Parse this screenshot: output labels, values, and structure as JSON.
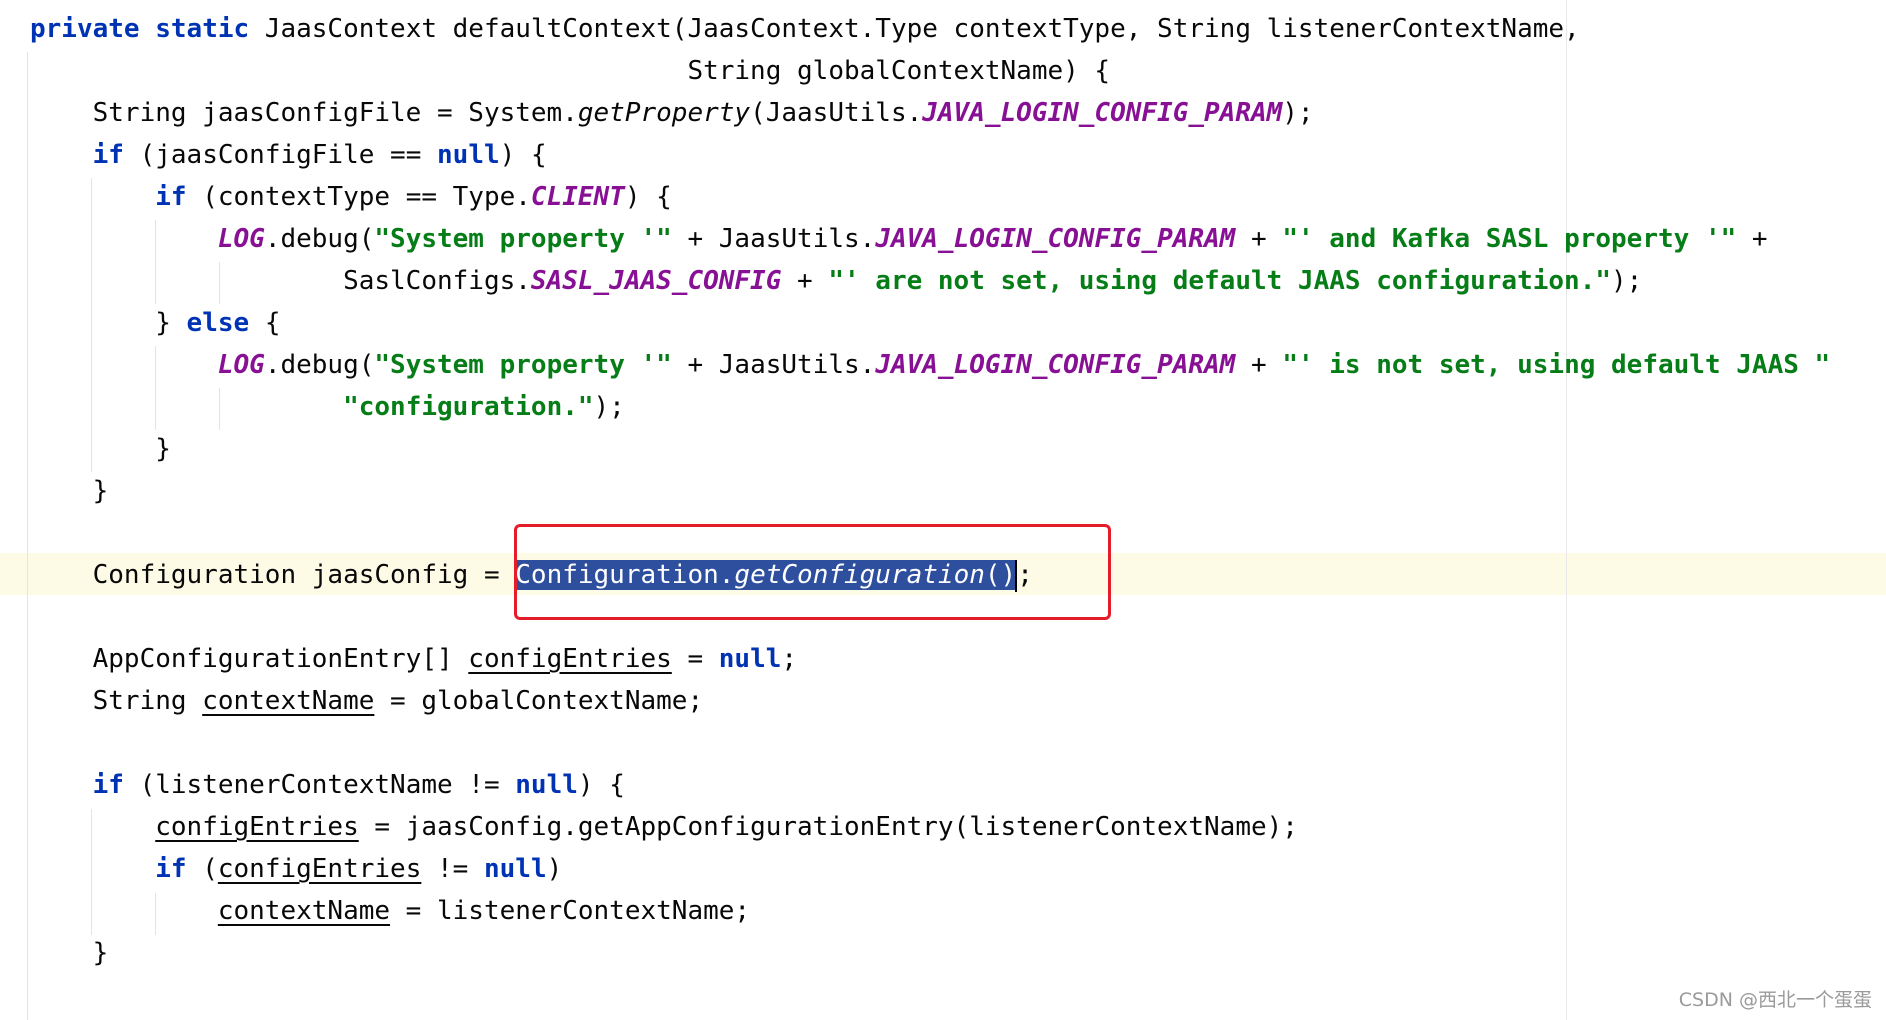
{
  "colors": {
    "keyword": "#0033b3",
    "string": "#067d17",
    "constant": "#871094",
    "selection": "#2e4f9e",
    "highlight_box": "#e51c2a",
    "caret_line": "#fdfbe6"
  },
  "code": {
    "l1": {
      "k1": "private",
      "k2": "static",
      "rest": " JaasContext defaultContext(JaasContext.Type contextType, String listenerContextName,"
    },
    "l2": {
      "text": "                                          String globalContextName) {"
    },
    "l3": {
      "a": "    String jaasConfigFile = System.",
      "m": "getProperty",
      "b": "(JaasUtils.",
      "c": "JAVA_LOGIN_CONFIG_PARAM",
      "d": ");"
    },
    "l4": {
      "indent": "    ",
      "k": "if",
      "a": " (jaasConfigFile == ",
      "n": "null",
      "b": ") {"
    },
    "l5": {
      "indent": "        ",
      "k": "if",
      "a": " (contextType == Type.",
      "c": "CLIENT",
      "b": ") {"
    },
    "l6": {
      "indent": "            ",
      "log": "LOG",
      "a": ".debug(",
      "s1": "\"System property '\"",
      "b": " + JaasUtils.",
      "c": "JAVA_LOGIN_CONFIG_PARAM",
      "d": " + ",
      "s2": "\"' and Kafka SASL property '\"",
      "e": " +"
    },
    "l7": {
      "indent": "                    SaslConfigs.",
      "c": "SASL_JAAS_CONFIG",
      "a": " + ",
      "s": "\"' are not set, using default JAAS configuration.\"",
      "b": ");"
    },
    "l8": {
      "a": "        } ",
      "k": "else",
      "b": " {"
    },
    "l9": {
      "indent": "            ",
      "log": "LOG",
      "a": ".debug(",
      "s1": "\"System property '\"",
      "b": " + JaasUtils.",
      "c": "JAVA_LOGIN_CONFIG_PARAM",
      "d": " + ",
      "s2": "\"' is not set, using default JAAS \""
    },
    "l10": {
      "indent": "                    ",
      "s": "\"configuration.\"",
      "b": ");"
    },
    "l11": {
      "text": "        }"
    },
    "l12": {
      "text": "    }"
    },
    "l14": {
      "a": "    Configuration jaasConfig = ",
      "sel_a": "Configuration.",
      "sel_m": "getConfiguration",
      "sel_b": "()",
      "b": ";"
    },
    "l16": {
      "a": "    AppConfigurationEntry[] ",
      "v": "configEntries",
      "b": " = ",
      "n": "null",
      "c": ";"
    },
    "l17": {
      "a": "    String ",
      "v": "contextName",
      "b": " = globalContextName;"
    },
    "l19": {
      "indent": "    ",
      "k": "if",
      "a": " (listenerContextName != ",
      "n": "null",
      "b": ") {"
    },
    "l20": {
      "indent": "        ",
      "v": "configEntries",
      "a": " = jaasConfig.getAppConfigurationEntry(listenerContextName);"
    },
    "l21": {
      "indent": "        ",
      "k": "if",
      "a": " (",
      "v": "configEntries",
      "b": " != ",
      "n": "null",
      "c": ")"
    },
    "l22": {
      "indent": "            ",
      "v": "contextName",
      "a": " = listenerContextName;"
    },
    "l23": {
      "text": "    }"
    }
  },
  "watermark": "CSDN @西北一个蛋蛋"
}
